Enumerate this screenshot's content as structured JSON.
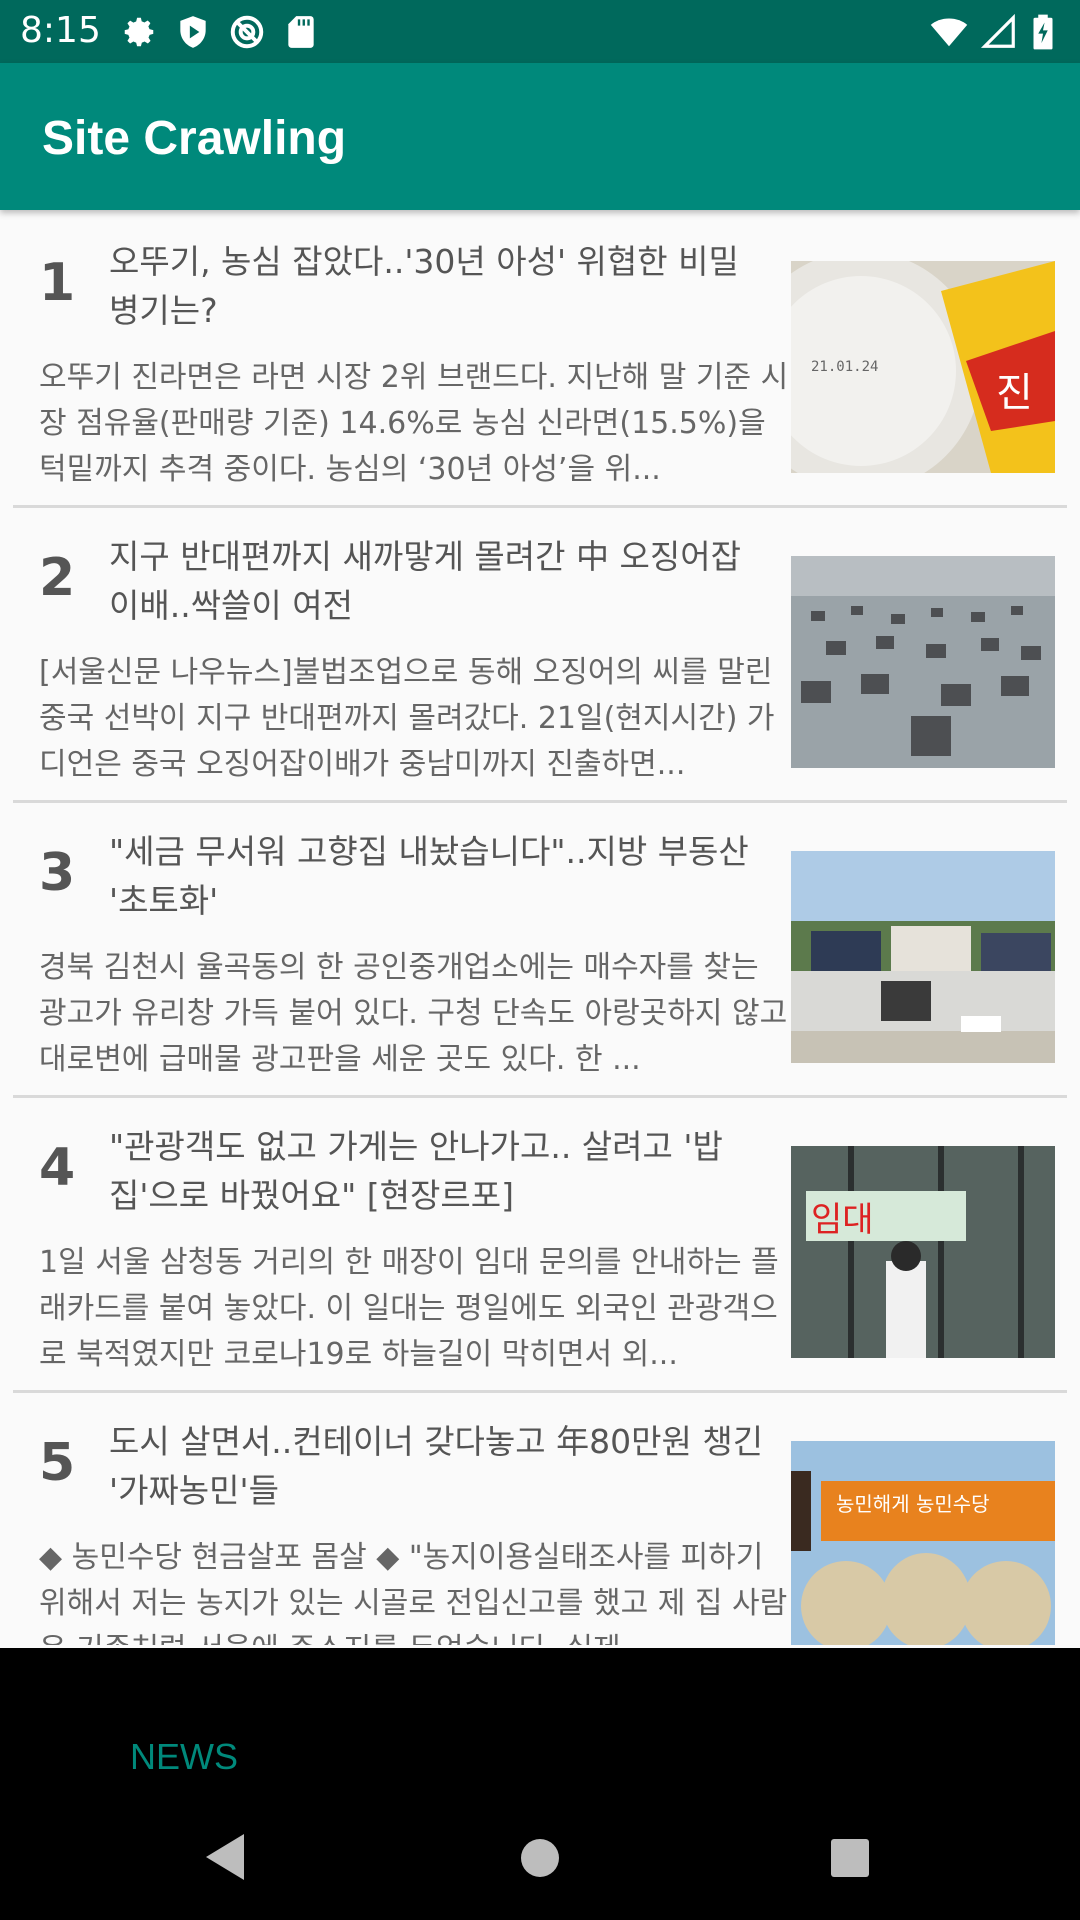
{
  "status_bar": {
    "time": "8:15"
  },
  "app_bar": {
    "title": "Site Crawling"
  },
  "news": [
    {
      "rank": "1",
      "title": "오뚜기, 농심 잡았다..'30년 아성' 위협한 비밀 병기는?",
      "summary": "오뚜기 진라면은 라면 시장 2위 브랜드다. 지난해 말 기준 시장 점유율(판매량 기준) 14.6%로 농심 신라면(15.5%)을 턱밑까지 추격 중이다. 농심의 ‘30년 아성’을 위..."
    },
    {
      "rank": "2",
      "title": "지구 반대편까지 새까맣게 몰려간 中 오징어잡이배..싹쓸이 여전",
      "summary": "[서울신문 나우뉴스]불법조업으로 동해 오징어의 씨를 말린 중국 선박이 지구 반대편까지 몰려갔다. 21일(현지시간) 가디언은 중국 오징어잡이배가 중남미까지 진출하면..."
    },
    {
      "rank": "3",
      "title": "\"세금 무서워 고향집 내놨습니다\"..지방 부동산 '초토화'",
      "summary": "경북 김천시 율곡동의 한 공인중개업소에는 매수자를 찾는 광고가 유리창 가득 붙어 있다. 구청 단속도 아랑곳하지 않고 대로변에 급매물 광고판을 세운 곳도 있다. 한 ..."
    },
    {
      "rank": "4",
      "title": "\"관광객도 없고 가게는 안나가고.. 살려고 '밥집'으로 바꿨어요\" [현장르포]",
      "summary": "1일 서울 삼청동 거리의 한 매장이 임대 문의를 안내하는 플래카드를 붙여 놓았다. 이 일대는 평일에도 외국인 관광객으로 북적였지만 코로나19로 하늘길이 막히면서 외..."
    },
    {
      "rank": "5",
      "title": "도시 살면서..컨테이너 갖다놓고 年80만원 챙긴 '가짜농민'들",
      "summary": "◆ 농민수당 현금살포 몸살 ◆ \"농지이용실태조사를 피하기 위해서 저는 농지가 있는 시골로 전입신고를 했고 제 집 사람은 기존처럼 서울에 주소지를 두었습니다. 실제..."
    }
  ],
  "tabs": {
    "news": "NEWS"
  }
}
